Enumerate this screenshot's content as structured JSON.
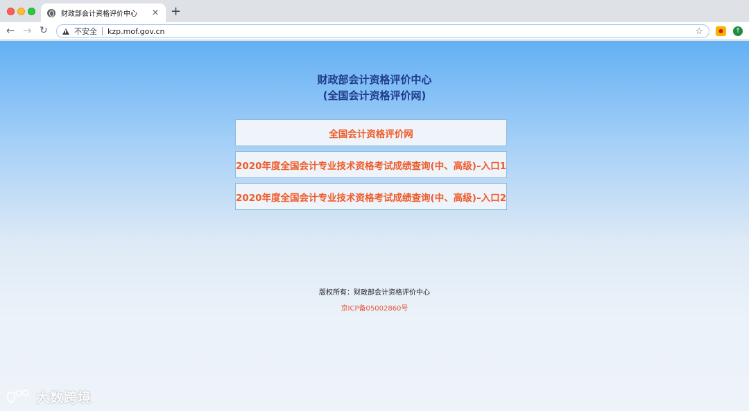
{
  "browser": {
    "tab_title": "财政部会计资格评价中心",
    "tab_close": "×",
    "new_tab": "+",
    "not_secure_label": "不安全",
    "url": "kzp.mof.gov.cn",
    "icons": {
      "back": "arrow-left-icon",
      "forward": "arrow-right-icon",
      "reload": "reload-icon",
      "warning": "warning-triangle-icon",
      "bookmark": "star-icon",
      "favicon": "globe-icon"
    }
  },
  "page": {
    "title_line1": "财政部会计资格评价中心",
    "title_line2": "(全国会计资格评价网)",
    "links": [
      {
        "label": "全国会计资格评价网"
      },
      {
        "label": "2020年度全国会计专业技术资格考试成绩查询(中、高级)–入口1"
      },
      {
        "label": "2020年度全国会计专业技术资格考试成绩查询(中、高级)–入口2"
      }
    ],
    "copyright": "版权所有：财政部会计资格评价中心",
    "icp": "京ICP备05002860号",
    "watermark_text": "大数跨境"
  },
  "colors": {
    "title": "#1f3a8a",
    "link_text": "#ef5a28",
    "icp_text": "#e8543a",
    "box_border": "#8fb8dc"
  }
}
